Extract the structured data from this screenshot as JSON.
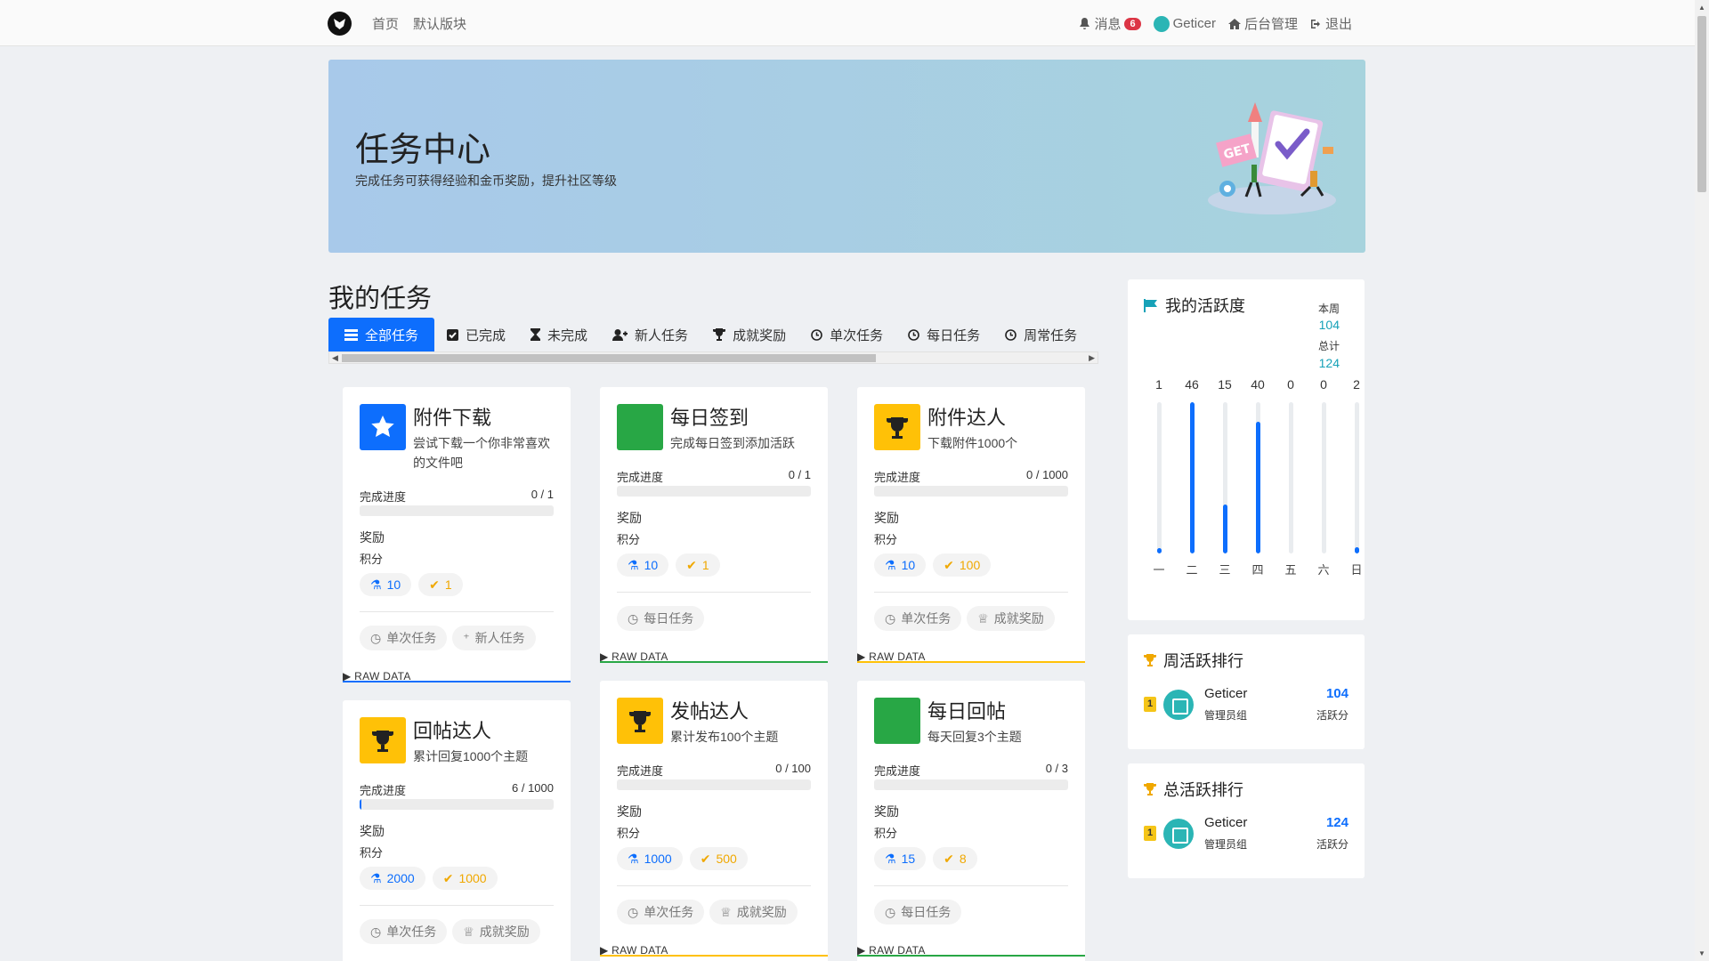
{
  "nav": {
    "links": [
      "首页",
      "默认版块"
    ],
    "messages_label": "消息",
    "messages_count": "6",
    "username": "Geticer",
    "admin_label": "后台管理",
    "logout_label": "退出"
  },
  "banner": {
    "title": "任务中心",
    "subtitle": "完成任务可获得经验和金币奖励，提升社区等级"
  },
  "tasks_section": {
    "title": "我的任务",
    "tabs": [
      {
        "label": "全部任务",
        "icon": "list-icon",
        "active": true
      },
      {
        "label": "已完成",
        "icon": "check-square-icon"
      },
      {
        "label": "未完成",
        "icon": "hourglass-icon"
      },
      {
        "label": "新人任务",
        "icon": "user-plus-icon"
      },
      {
        "label": "成就奖励",
        "icon": "trophy-icon"
      },
      {
        "label": "单次任务",
        "icon": "clock-icon"
      },
      {
        "label": "每日任务",
        "icon": "clock-icon"
      },
      {
        "label": "周常任务",
        "icon": "clock-icon"
      }
    ],
    "labels": {
      "progress": "完成进度",
      "reward": "奖励",
      "points": "积分",
      "raw": "RAW DATA"
    },
    "cards": [
      {
        "title": "附件下载",
        "desc": "尝试下载一个你非常喜欢的文件吧",
        "icon": "star-icon",
        "icon_color": "#0d6efd",
        "progress_text": "0 / 1",
        "progress": 0,
        "exp": "10",
        "gold": "1",
        "tags": [
          {
            "label": "单次任务",
            "icon": "clock-icon"
          },
          {
            "label": "新人任务",
            "icon": "user-plus-icon"
          }
        ],
        "accent": "#0d6efd"
      },
      {
        "title": "每日签到",
        "desc": "完成每日签到添加活跃",
        "icon": "square-icon",
        "icon_color": "#28a745",
        "progress_text": "0 / 1",
        "progress": 0,
        "exp": "10",
        "gold": "1",
        "tags": [
          {
            "label": "每日任务",
            "icon": "clock-icon"
          }
        ],
        "accent": "#28a745"
      },
      {
        "title": "附件达人",
        "desc": "下载附件1000个",
        "icon": "trophy-icon",
        "icon_color": "#ffc107",
        "progress_text": "0 / 1000",
        "progress": 0,
        "exp": "10",
        "gold": "100",
        "tags": [
          {
            "label": "单次任务",
            "icon": "clock-icon"
          },
          {
            "label": "成就奖励",
            "icon": "trophy-icon"
          }
        ],
        "accent": "#ffc107"
      },
      {
        "title": "回帖达人",
        "desc": "累计回复1000个主题",
        "icon": "trophy-icon",
        "icon_color": "#ffc107",
        "progress_text": "6 / 1000",
        "progress": 0.006,
        "exp": "2000",
        "gold": "1000",
        "tags": [
          {
            "label": "单次任务",
            "icon": "clock-icon"
          },
          {
            "label": "成就奖励",
            "icon": "trophy-icon"
          }
        ],
        "accent": "#ffc107"
      },
      {
        "title": "发帖达人",
        "desc": "累计发布100个主题",
        "icon": "trophy-icon",
        "icon_color": "#ffc107",
        "progress_text": "0 / 100",
        "progress": 0,
        "exp": "1000",
        "gold": "500",
        "tags": [
          {
            "label": "单次任务",
            "icon": "clock-icon"
          },
          {
            "label": "成就奖励",
            "icon": "trophy-icon"
          }
        ],
        "accent": "#ffc107"
      },
      {
        "title": "每日回帖",
        "desc": "每天回复3个主题",
        "icon": "square-icon",
        "icon_color": "#28a745",
        "progress_text": "0 / 3",
        "progress": 0,
        "exp": "15",
        "gold": "8",
        "tags": [
          {
            "label": "每日任务",
            "icon": "clock-icon"
          }
        ],
        "accent": "#28a745"
      }
    ]
  },
  "activity": {
    "title": "我的活跃度",
    "week_label": "本周",
    "week_value": "104",
    "total_label": "总计",
    "total_value": "124",
    "days": [
      {
        "day": "一",
        "value": 1
      },
      {
        "day": "二",
        "value": 46
      },
      {
        "day": "三",
        "value": 15
      },
      {
        "day": "四",
        "value": 40
      },
      {
        "day": "五",
        "value": 0
      },
      {
        "day": "六",
        "value": 0
      },
      {
        "day": "日",
        "value": 2
      }
    ],
    "max": 46
  },
  "weekly_rank": {
    "title": "周活跃排行",
    "rank": "1",
    "name": "Geticer",
    "group": "管理员组",
    "score": "104",
    "unit": "活跃分"
  },
  "total_rank": {
    "title": "总活跃排行",
    "rank": "1",
    "name": "Geticer",
    "group": "管理员组",
    "score": "124",
    "unit": "活跃分"
  },
  "colors": {
    "primary": "#0d6efd",
    "gold": "#f0a800",
    "teal": "#17a2b8"
  }
}
